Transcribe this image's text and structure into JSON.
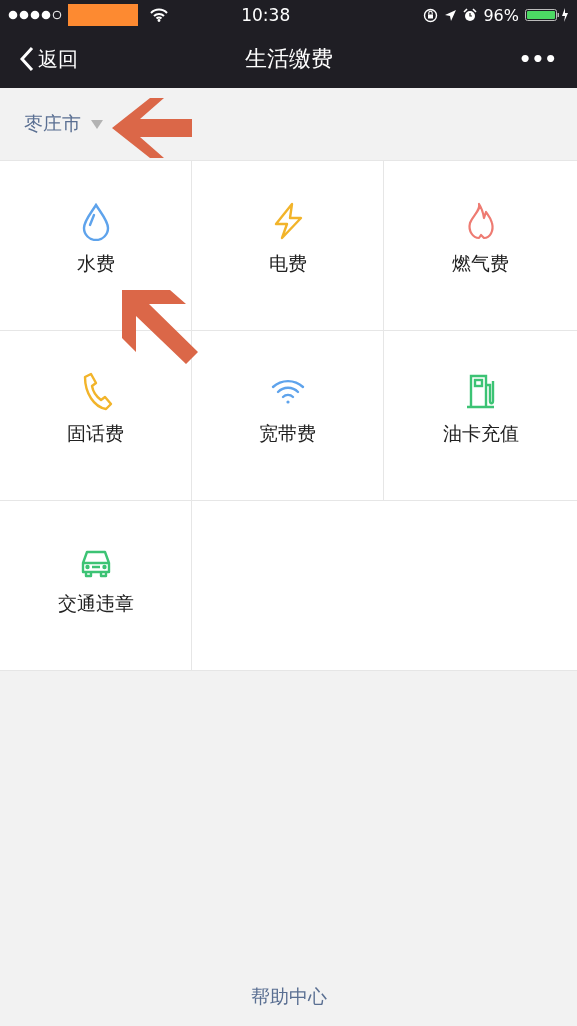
{
  "status_bar": {
    "time": "10:38",
    "battery": "96%"
  },
  "nav_bar": {
    "back": "返回",
    "title": "生活缴费",
    "more": "•••"
  },
  "city": {
    "name": "枣庄市"
  },
  "services": [
    {
      "label": "水费",
      "kind": "drop",
      "color": "#5ea3ec"
    },
    {
      "label": "电费",
      "kind": "bolt",
      "color": "#f2b42a"
    },
    {
      "label": "燃气费",
      "kind": "flame",
      "color": "#ee7b72"
    },
    {
      "label": "固话费",
      "kind": "phone",
      "color": "#f2b42a"
    },
    {
      "label": "宽带费",
      "kind": "wifi",
      "color": "#5ea3ec"
    },
    {
      "label": "油卡充值",
      "kind": "fuel",
      "color": "#3cc374"
    },
    {
      "label": "交通违章",
      "kind": "car",
      "color": "#3cc374"
    }
  ],
  "footer": {
    "link": "帮助中心"
  }
}
